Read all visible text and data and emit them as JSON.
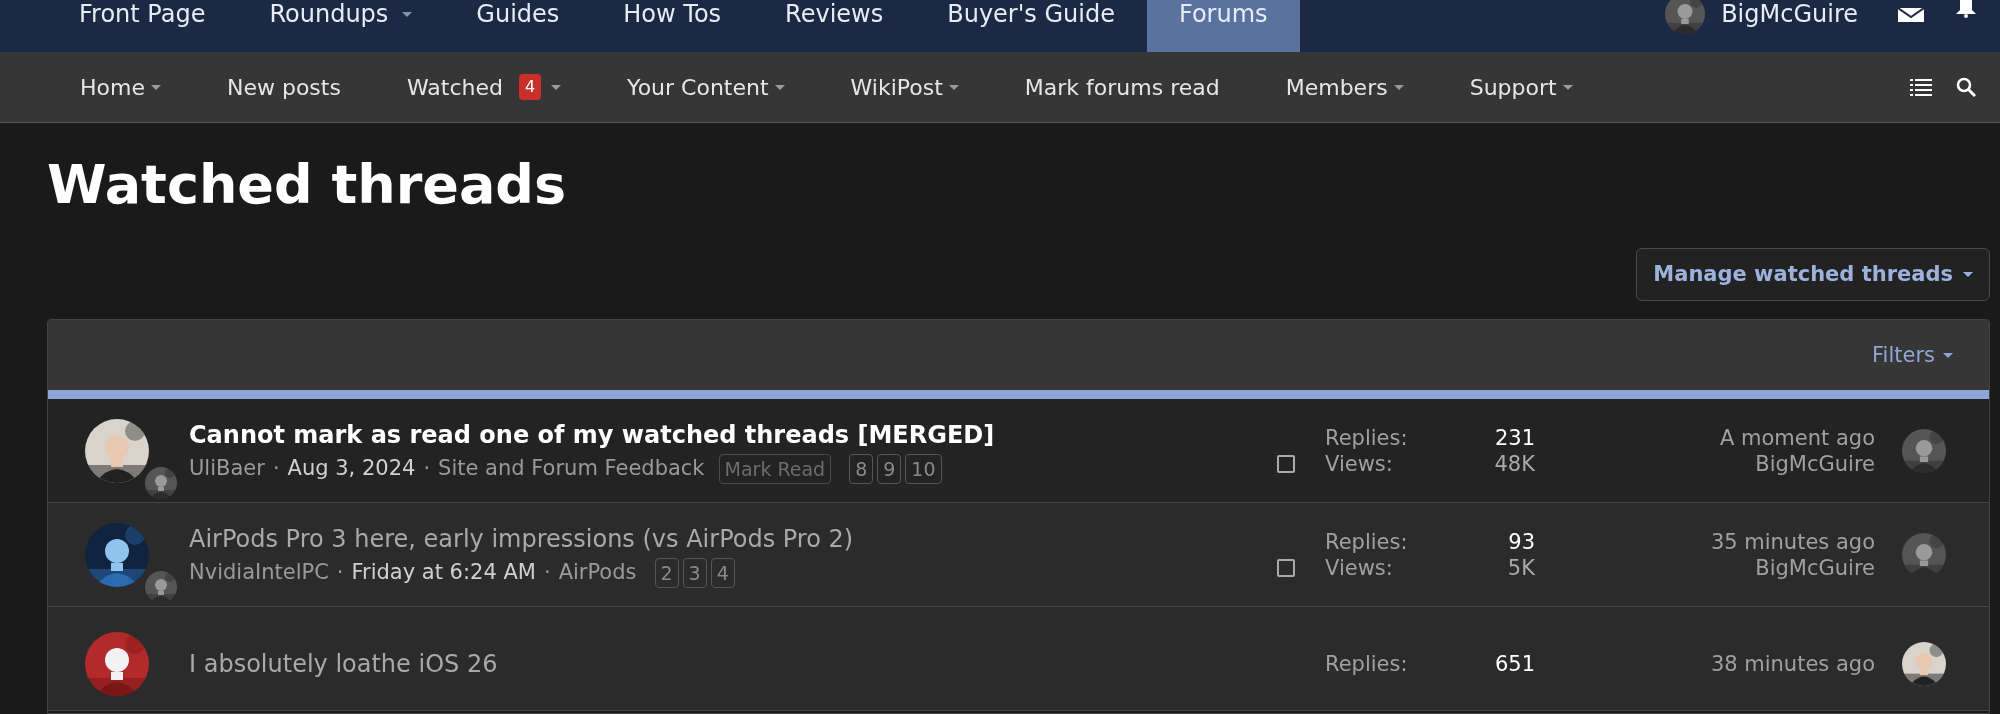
{
  "top_nav": {
    "items": [
      {
        "label": "Front Page",
        "selected": false,
        "has_menu": false
      },
      {
        "label": "Roundups",
        "selected": false,
        "has_menu": true
      },
      {
        "label": "Guides",
        "selected": false,
        "has_menu": false
      },
      {
        "label": "How Tos",
        "selected": false,
        "has_menu": false
      },
      {
        "label": "Reviews",
        "selected": false,
        "has_menu": false
      },
      {
        "label": "Buyer's Guide",
        "selected": false,
        "has_menu": false
      },
      {
        "label": "Forums",
        "selected": true,
        "has_menu": false
      }
    ],
    "user": "BigMcGuire"
  },
  "sub_nav": {
    "items": [
      {
        "label": "Home",
        "has_menu": true
      },
      {
        "label": "New posts",
        "has_menu": false
      },
      {
        "label": "Watched",
        "badge": "4",
        "has_menu": true
      },
      {
        "label": "Your Content",
        "has_menu": true
      },
      {
        "label": "WikiPost",
        "has_menu": true
      },
      {
        "label": "Mark forums read",
        "has_menu": false
      },
      {
        "label": "Members",
        "has_menu": true
      },
      {
        "label": "Support",
        "has_menu": true
      }
    ]
  },
  "page_title": "Watched threads",
  "manage_button": "Manage watched threads",
  "filters": "Filters",
  "threads": [
    {
      "title": "Cannot mark as read one of my watched threads [MERGED]",
      "unread": true,
      "meta": [
        {
          "kind": "author",
          "text": "UliBaer"
        },
        {
          "kind": "sep",
          "text": "·"
        },
        {
          "kind": "date",
          "text": "Aug 3, 2024"
        },
        {
          "kind": "sep",
          "text": "·"
        },
        {
          "kind": "forum",
          "text": "Site and Forum Feedback"
        }
      ],
      "tag": "Mark Read",
      "pages": [
        "8",
        "9",
        "10"
      ],
      "checked": false,
      "replies_label": "Replies:",
      "replies": "231",
      "views_label": "Views:",
      "views": "48K",
      "last_time": "A moment ago",
      "last_user": "BigMcGuire"
    },
    {
      "title": "AirPods Pro 3 here, early impressions (vs AirPods Pro 2)",
      "unread": false,
      "meta": [
        {
          "kind": "author",
          "text": "NvidiaIntelPC"
        },
        {
          "kind": "sep",
          "text": "·"
        },
        {
          "kind": "date",
          "text": "Friday at 6:24 AM"
        },
        {
          "kind": "sep",
          "text": "·"
        },
        {
          "kind": "forum",
          "text": "AirPods"
        }
      ],
      "pages": [
        "2",
        "3",
        "4"
      ],
      "checked": false,
      "replies_label": "Replies:",
      "replies": "93",
      "views_label": "Views:",
      "views": "5K",
      "last_time": "35 minutes ago",
      "last_user": "BigMcGuire"
    },
    {
      "title": "I absolutely loathe iOS 26",
      "unread": false,
      "replies_label": "Replies:",
      "replies": "651",
      "last_time": "38 minutes ago"
    }
  ]
}
